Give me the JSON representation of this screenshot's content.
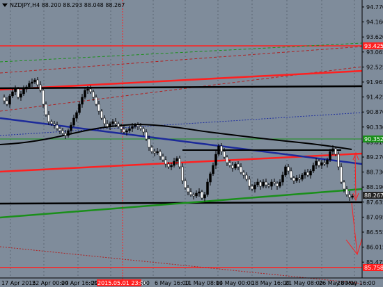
{
  "symbol_info": "NZDJPY,H4  88.200 88.293 88.048 88.267",
  "price_scale": [
    "94.770",
    "94.160",
    "93.620",
    "93.065",
    "92.525",
    "91.965",
    "91.425",
    "90.870",
    "90.330",
    "89.810",
    "89.270",
    "88.730",
    "88.190",
    "87.635",
    "87.095",
    "86.555",
    "86.015",
    "85.475"
  ],
  "price_tags": [
    {
      "value": "93.425",
      "color": "#ff2020"
    },
    {
      "value": "90.352",
      "color": "#1a8f1a"
    },
    {
      "value": "88.267",
      "color": "#222222"
    },
    {
      "value": "85.758",
      "color": "#ff2020"
    }
  ],
  "time_scale": [
    "17 Apr 2015",
    "22 Apr 00:00",
    "24 Apr 16:00",
    "29 A",
    "2015.05.01 23:00",
    ":00",
    "6 May 16:00",
    "11 May 08:00",
    "14 May 00:00",
    "18 May 16:00",
    "21 May 08:00",
    "26 May 00:00",
    "28 May 16:00"
  ],
  "highlight_time": "2015.05.01 23:00",
  "colors": {
    "background": "#7f8c9b",
    "bull": "#000000",
    "bear": "#ffffff",
    "support": "#ff2020",
    "ma_green": "#1a8f1a",
    "trend_blue": "#1c2a9a"
  }
}
